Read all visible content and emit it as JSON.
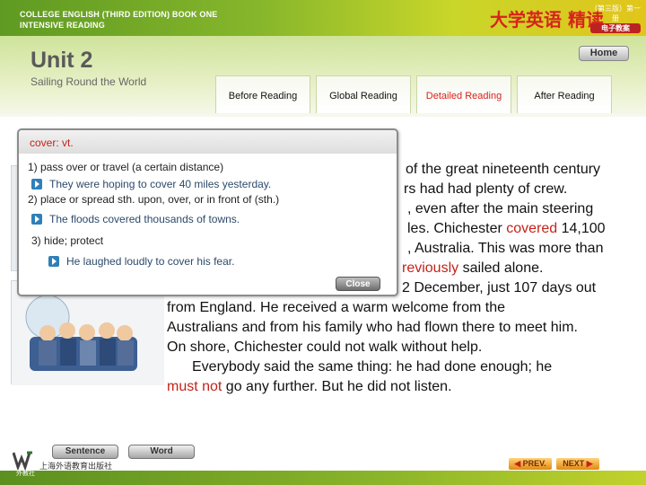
{
  "banner": {
    "course_line1": "COLLEGE ENGLISH (THIRD EDITION)  BOOK ONE",
    "course_line2": "INTENSIVE READING",
    "cn_title": "大学英语 精读",
    "cn_sub_line1": "（第三版）第一册",
    "cn_sub_line2": "电子教案"
  },
  "header": {
    "unit_title": "Unit 2",
    "unit_subtitle": "Sailing Round the World",
    "home_label": "Home"
  },
  "tabs": [
    {
      "label": "Before Reading"
    },
    {
      "label": "Global Reading"
    },
    {
      "label": "Detailed Reading"
    },
    {
      "label": "After Reading"
    }
  ],
  "popup": {
    "word": "cover: vt.",
    "def1": "1) pass over or travel (a certain distance)",
    "ex1": "They were hoping to cover 40 miles yesterday.",
    "def2": "2) place or spread sth. upon, over, or in front of (sth.)",
    "ex2": "The floods covered thousands of towns.",
    "def3": "3) hide; protect",
    "ex3": "He laughed loudly to cover his fear.",
    "close_label": "Close"
  },
  "text": {
    "l1": "of the great nineteenth century",
    "l2": "rs had had plenty of crew.",
    "l3": ", even after the main steering",
    "l4a": "les. Chichester ",
    "l4b": "covered",
    "l4c": " 14,100",
    "l5": ", Australia. This was more than",
    "l6a": "reviously",
    "l6b": " sailed alone.",
    "l7": "2 December, just 107 days out",
    "l8": "from England. He received a warm welcome from the",
    "l9": "Australians and from his family who had flown there to meet him.",
    "l10": "On shore, Chichester could not walk without help.",
    "l11": "Everybody said the same thing: he had done enough; he",
    "l12a": "must not",
    "l12b": " go any further. But he did not listen."
  },
  "footer": {
    "sentence_label": "Sentence",
    "word_label": "Word",
    "publisher": "上海外语教育出版社",
    "logo_caption": "外教社",
    "prev_label": "PREV.",
    "next_label": "NEXT"
  },
  "colors": {
    "accent_red": "#c3231a",
    "banner_green": "#86b62b"
  }
}
